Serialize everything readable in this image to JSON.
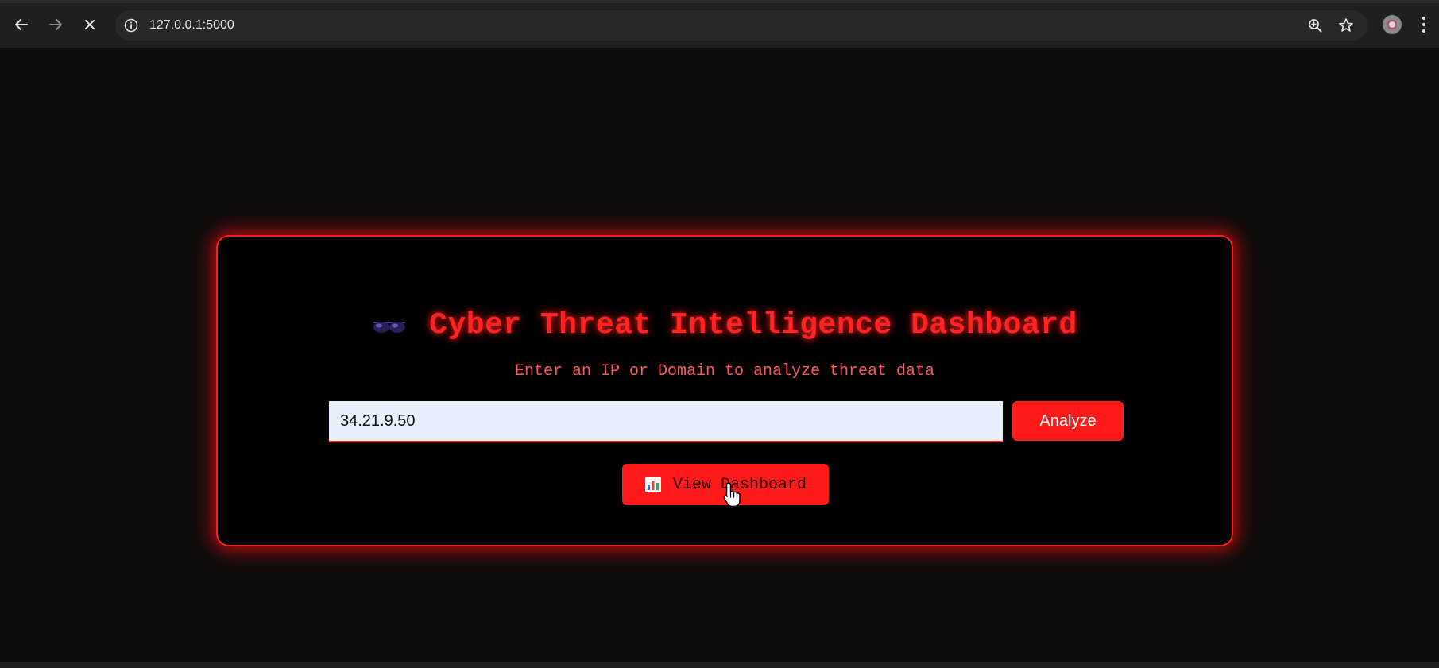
{
  "browser": {
    "url": "127.0.0.1:5000",
    "icons": [
      "back-icon",
      "forward-icon",
      "stop-icon",
      "site-info-icon",
      "zoom-icon",
      "bookmark-star-icon",
      "profile-avatar",
      "menu-icon"
    ]
  },
  "page": {
    "title_emoji": "sunglasses-emoji",
    "title": "Cyber Threat Intelligence Dashboard",
    "subtitle": "Enter an IP or Domain to analyze threat data",
    "search": {
      "value": "34.21.9.50",
      "placeholder": ""
    },
    "analyze_label": "Analyze",
    "dashboard_icon": "bar-chart-emoji",
    "dashboard_label": "View Dashboard"
  },
  "colors": {
    "accent": "#ff1a1a",
    "title": "#ff2323",
    "subtitle": "#ff5a5a",
    "background": "#0d0d0d",
    "card": "#000000",
    "input_bg": "#e8f0fe"
  }
}
